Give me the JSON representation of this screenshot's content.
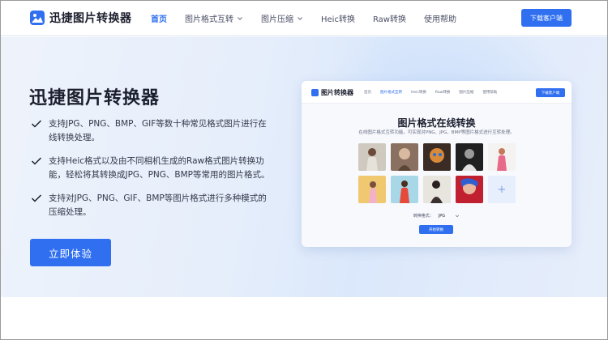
{
  "header": {
    "logo_text": "迅捷图片转换器",
    "nav": [
      {
        "label": "首页",
        "active": true,
        "dropdown": false
      },
      {
        "label": "图片格式互转",
        "active": false,
        "dropdown": true
      },
      {
        "label": "图片压缩",
        "active": false,
        "dropdown": true
      },
      {
        "label": "Heic转换",
        "active": false,
        "dropdown": false
      },
      {
        "label": "Raw转换",
        "active": false,
        "dropdown": false
      },
      {
        "label": "使用帮助",
        "active": false,
        "dropdown": false
      }
    ],
    "download_button": "下载客户端"
  },
  "hero": {
    "title": "迅捷图片转换器",
    "features": [
      "支持JPG、PNG、BMP、GIF等数十种常见格式图片进行在线转换处理。",
      "支持Heic格式以及由不同相机生成的Raw格式图片转换功能，轻松将其转换成JPG、PNG、BMP等常用的图片格式。",
      "支持对JPG、PNG、GIF、BMP等图片格式进行多种模式的压缩处理。"
    ],
    "cta_button": "立即体验"
  },
  "preview": {
    "logo_text": "图片转换器",
    "nav": [
      "首页",
      "图片格式互转",
      "Heic转换",
      "Raw转换",
      "图片压缩",
      "使用帮助"
    ],
    "download_button": "下载客户端",
    "title": "图片格式在线转换",
    "subtitle": "在线图片格式互转功能，可实现对PNG、JPG、BMP等图片格式进行互转处理。",
    "format_label": "转换格式：",
    "format_value": "JPG",
    "start_button": "开始转换",
    "add_symbol": "+"
  },
  "colors": {
    "accent": "#2f6ff0",
    "text_dark": "#1c1f2e",
    "hero_bg": "#e6eefb"
  }
}
